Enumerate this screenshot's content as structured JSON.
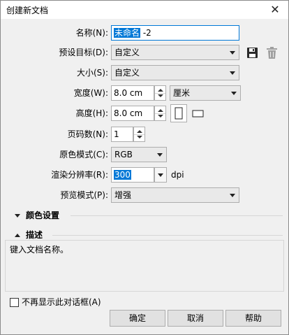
{
  "window": {
    "title": "创建新文档",
    "close_glyph": "✕"
  },
  "fields": {
    "name": {
      "label": "名称(N):",
      "value_prefix": "未命名",
      "value_suffix": " -2"
    },
    "preset": {
      "label": "预设目标(D):",
      "value": "自定义"
    },
    "size": {
      "label": "大小(S):",
      "value": "自定义"
    },
    "width": {
      "label": "宽度(W):",
      "value": "8.0 cm",
      "unit": "厘米"
    },
    "height": {
      "label": "高度(H):",
      "value": "8.0 cm"
    },
    "pages": {
      "label": "页码数(N):",
      "value": "1"
    },
    "color_mode": {
      "label": "原色模式(C):",
      "value": "RGB"
    },
    "resolution": {
      "label": "渲染分辨率(R):",
      "value": "300",
      "unit": "dpi"
    },
    "preview_mode": {
      "label": "预览模式(P):",
      "value": "增强"
    }
  },
  "sections": {
    "color_settings": "颜色设置",
    "description": "描述"
  },
  "description_text": "键入文档名称。",
  "footer": {
    "dont_show_label": "不再显示此对话框(A)",
    "ok": "确定",
    "cancel": "取消",
    "help": "帮助"
  }
}
